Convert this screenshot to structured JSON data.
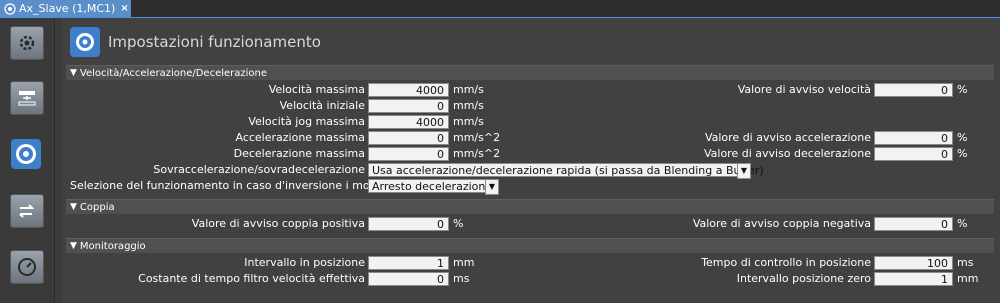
{
  "tab": {
    "label": "Ax_Slave (1,MC1)",
    "close": "×"
  },
  "header": {
    "title": "Impostazioni funzionamento"
  },
  "sections": {
    "vel": "Velocità/Accelerazione/Decelerazione",
    "torque": "Coppia",
    "monitor": "Monitoraggio"
  },
  "vel": {
    "max_speed": {
      "label": "Velocità massima",
      "value": "4000",
      "unit": "mm/s"
    },
    "start_speed": {
      "label": "Velocità iniziale",
      "value": "0",
      "unit": "mm/s"
    },
    "jog_max": {
      "label": "Velocità jog massima",
      "value": "4000",
      "unit": "mm/s"
    },
    "max_acc": {
      "label": "Accelerazione massima",
      "value": "0",
      "unit": "mm/s^2"
    },
    "max_dec": {
      "label": "Decelerazione massima",
      "value": "0",
      "unit": "mm/s^2"
    },
    "speed_warn": {
      "label": "Valore di avviso velocità",
      "value": "0",
      "unit": "%"
    },
    "acc_warn": {
      "label": "Valore di avviso accelerazione",
      "value": "0",
      "unit": "%"
    },
    "dec_warn": {
      "label": "Valore di avviso decelerazione",
      "value": "0",
      "unit": "%"
    },
    "overshoot": {
      "label": "Sovraccelerazione/sovradecelerazione",
      "value": "Usa accelerazione/decelerazione rapida (si passa da Blending a Buffer)"
    },
    "reversal": {
      "label": "Selezione del funzionamento in caso d'inversione i moto",
      "value": "Arresto decelerazione"
    }
  },
  "torque": {
    "pos_warn": {
      "label": "Valore di avviso coppia positiva",
      "value": "0",
      "unit": "%"
    },
    "neg_warn": {
      "label": "Valore di avviso coppia negativa",
      "value": "0",
      "unit": "%"
    }
  },
  "monitor": {
    "in_pos": {
      "label": "Intervallo in posizione",
      "value": "1",
      "unit": "mm"
    },
    "filter": {
      "label": "Costante di tempo filtro velocità effettiva",
      "value": "0",
      "unit": "ms"
    },
    "check_time": {
      "label": "Tempo di controllo in posizione",
      "value": "100",
      "unit": "ms"
    },
    "zero_range": {
      "label": "Intervallo posizione zero",
      "value": "1",
      "unit": "mm"
    }
  },
  "icons": {
    "tab": "axis-icon",
    "tools": [
      "settings-gear-icon",
      "unit-conversion-icon",
      "operation-settings-icon",
      "transfer-arrows-icon",
      "gauge-icon"
    ]
  },
  "colors": {
    "accent": "#3f7fc9",
    "tab_active": "#5b8fc9",
    "field_bg": "#f2f2f2"
  }
}
